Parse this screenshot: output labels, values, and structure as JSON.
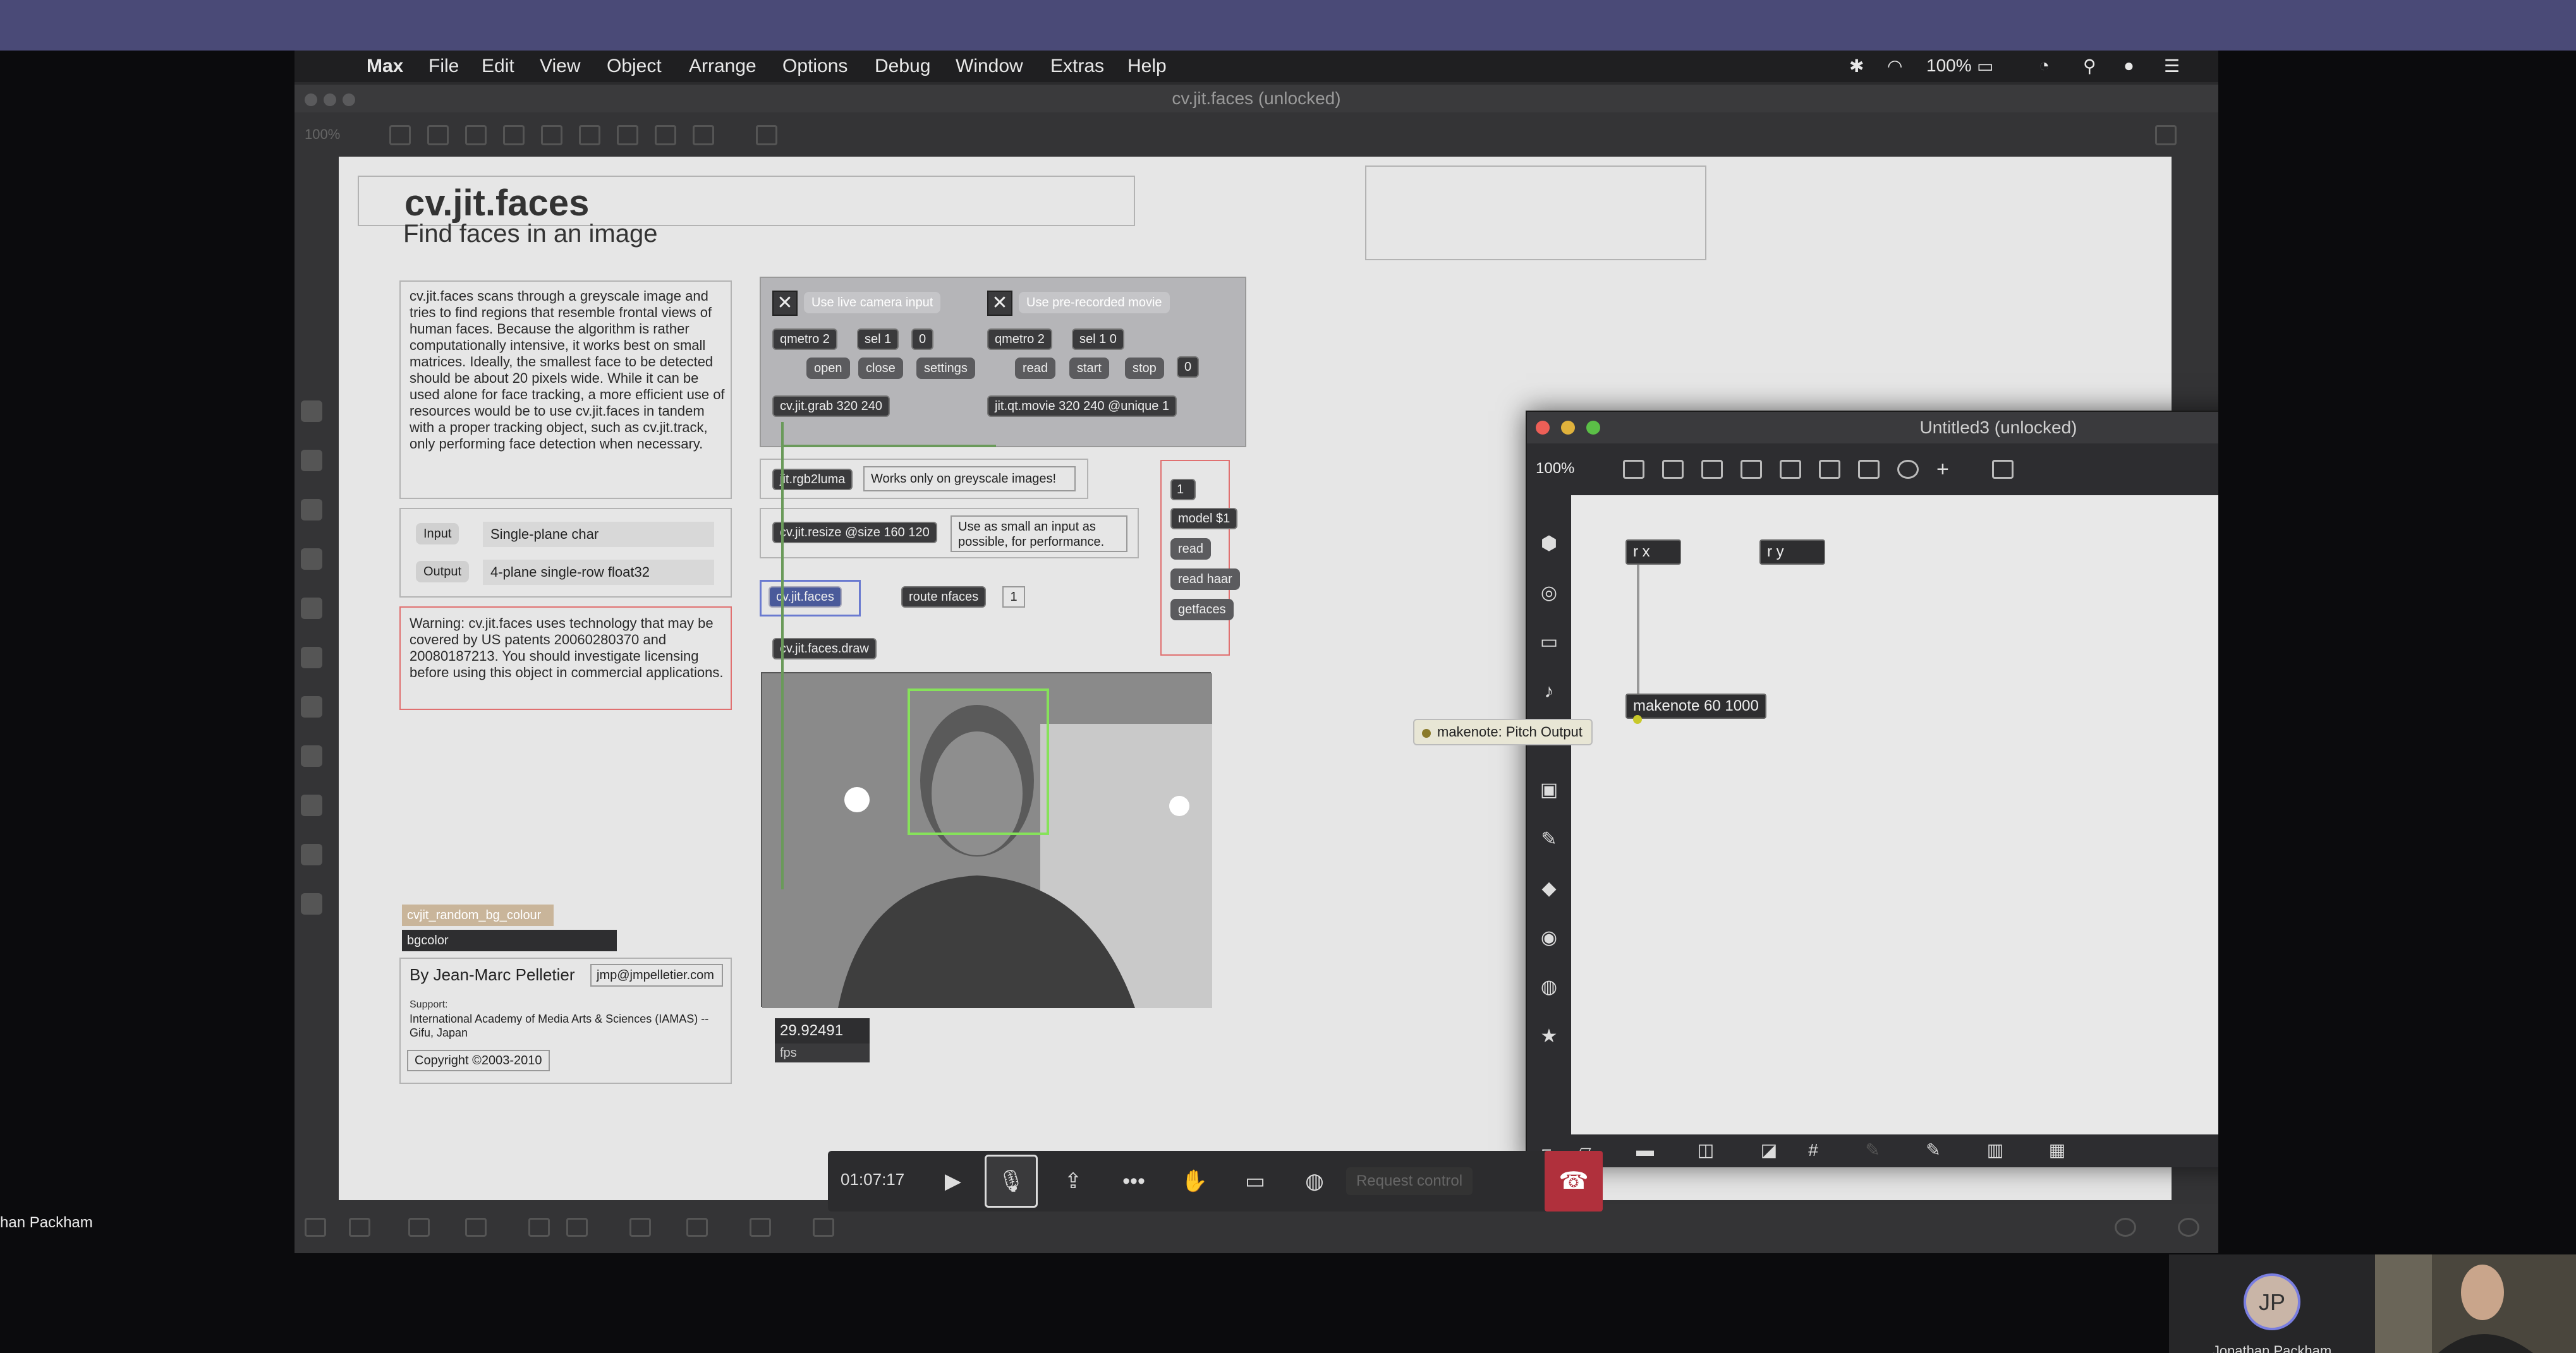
{
  "menubar": {
    "app": "Max",
    "items": [
      "File",
      "Edit",
      "View",
      "Object",
      "Arrange",
      "Options",
      "Debug",
      "Window",
      "Extras",
      "Help"
    ],
    "battery": "100%"
  },
  "main_window": {
    "title": "cv.jit.faces (unlocked)",
    "zoom": "100%"
  },
  "patch": {
    "title": "cv.jit.faces",
    "subtitle": "Find faces in an image",
    "description": "cv.jit.faces scans through a greyscale image and tries to find regions that resemble frontal views of human faces. Because the algorithm is rather computationally intensive, it works best on small matrices. Ideally, the smallest face to be detected should be about 20 pixels wide. While it can be used alone for face tracking, a more efficient use of resources would be to use cv.jit.faces in tandem with a proper tracking object, such as cv.jit.track, only performing face detection when necessary.",
    "io": [
      {
        "label": "Input",
        "value": "Single-plane char"
      },
      {
        "label": "Output",
        "value": "4-plane single-row float32"
      }
    ],
    "warning": "Warning: cv.jit.faces uses technology that may be covered by US patents 20060280370 and 20080187213. You should investigate licensing before using this object in commercial applications.",
    "live_camera": "Use live camera input",
    "prerecorded": "Use pre-recorded movie",
    "qmetro_a": "qmetro 2",
    "sel_a": "sel 1",
    "num_a": "0",
    "open": "open",
    "close": "close",
    "settings": "settings",
    "qmetro_b": "qmetro 2",
    "sel_b": "sel 1 0",
    "read": "read",
    "start": "start",
    "stop": "stop",
    "num_b": "0",
    "grab": "cv.jit.grab 320 240",
    "movie": "jit.qt.movie 320 240 @unique 1",
    "rgb2luma": "jit.rgb2luma",
    "greyscale_note": "Works only on greyscale images!",
    "resize": "cv.jit.resize @size 160 120",
    "resize_note": "Use as small an input as possible, for performance.",
    "faces": "cv.jit.faces",
    "route": "route nfaces",
    "route_num": "1",
    "draw": "cv.jit.faces.draw",
    "msg_one": "1",
    "model": "model $1",
    "read2": "read",
    "read_haar": "read haar",
    "getfaces": "getfaces",
    "fps_value": "29.92491",
    "fps_label": "fps",
    "random_bg": "cvjit_random_bg_colour",
    "bgcolor": "bgcolor",
    "author": "By Jean-Marc Pelletier",
    "email": "jmp@jmpelletier.com",
    "support_label": "Support:",
    "support": "International Academy of Media Arts & Sciences (IAMAS) -- Gifu, Japan",
    "copyright": "Copyright ©2003-2010"
  },
  "untitled_window": {
    "title": "Untitled3 (unlocked)",
    "zoom": "100%",
    "objects": {
      "rx": "r x",
      "ry": "r y",
      "makenote": "makenote 60 1000"
    },
    "tooltip": "makenote: Pitch Output"
  },
  "call": {
    "timer": "01:07:17",
    "request_control": "Request control"
  },
  "participants": {
    "left_name": "han Packham",
    "initials": "JP",
    "name": "Jonathan Packham"
  }
}
